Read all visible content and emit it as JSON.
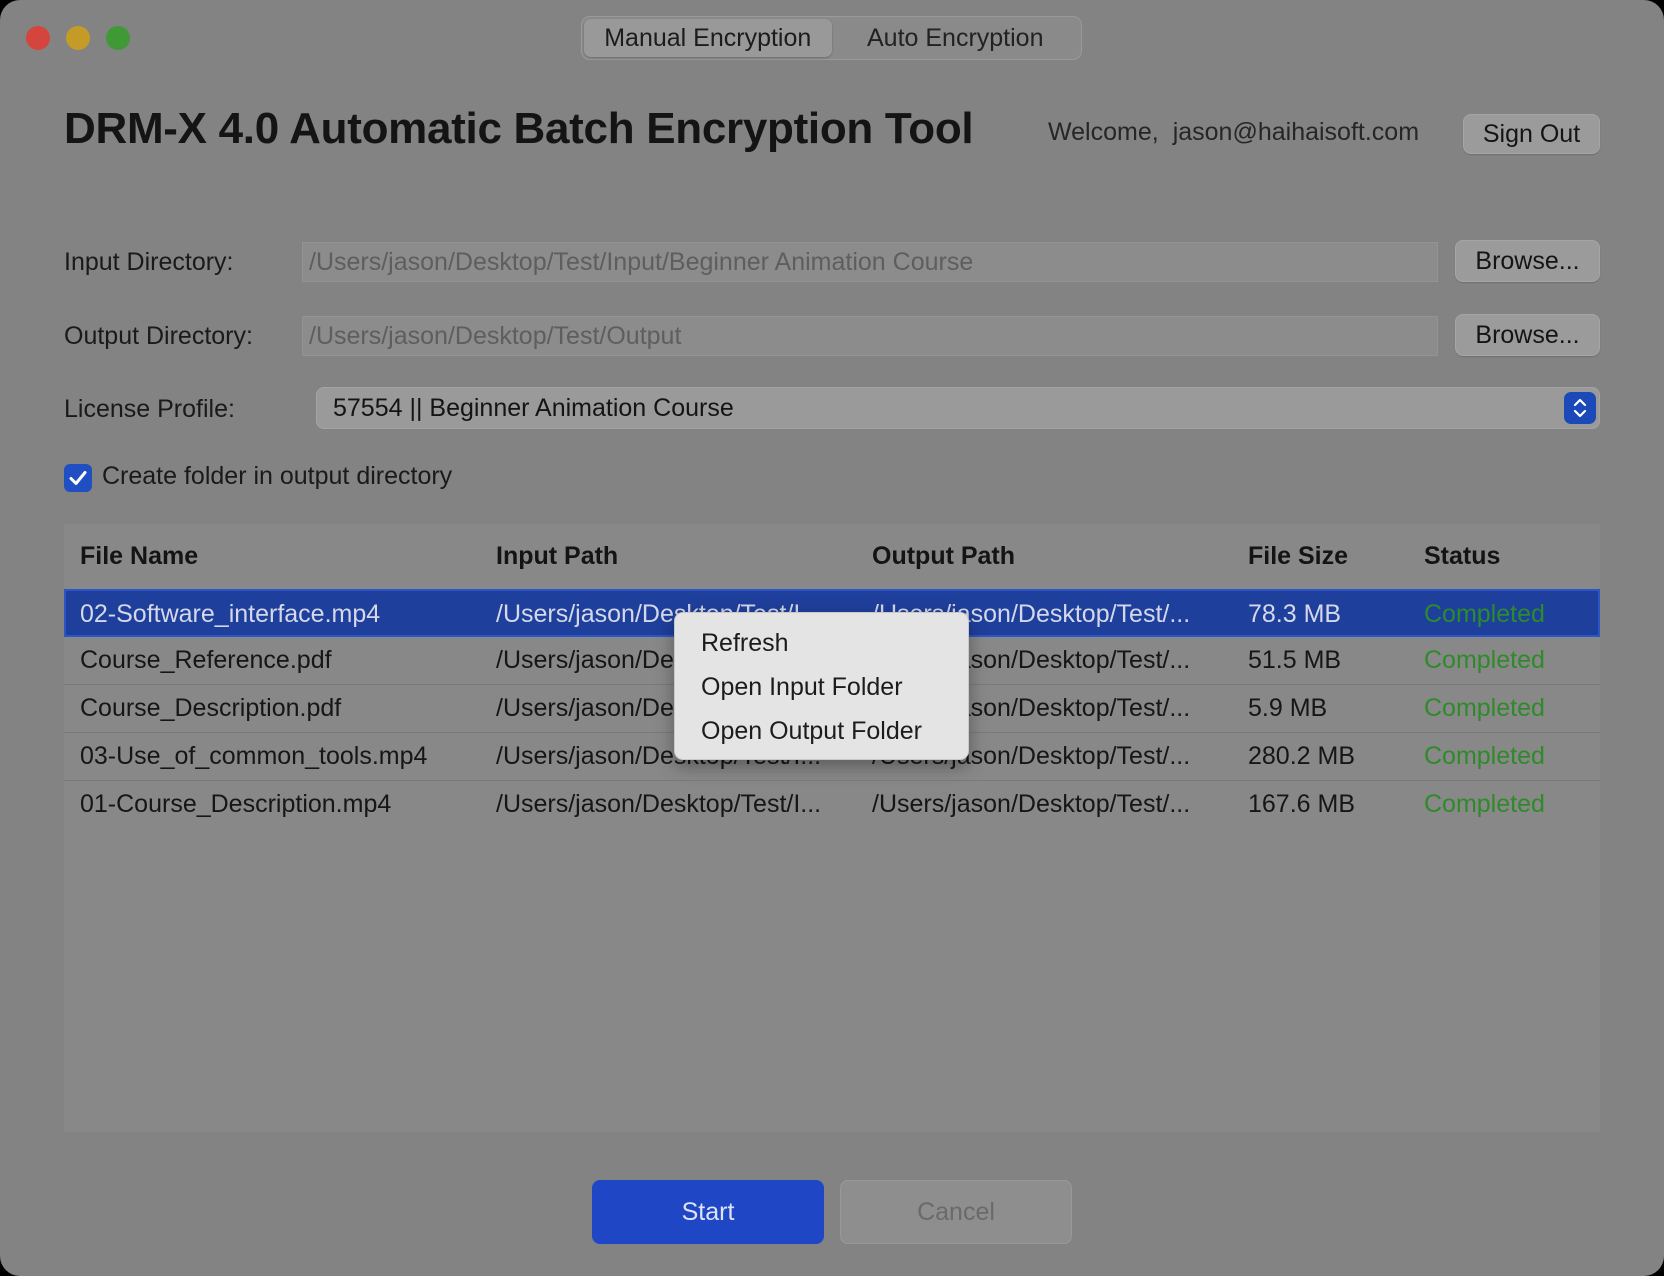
{
  "tabs": [
    {
      "label": "Manual Encryption",
      "active": true
    },
    {
      "label": "Auto Encryption",
      "active": false
    }
  ],
  "header": {
    "title": "DRM-X 4.0 Automatic Batch Encryption Tool",
    "welcome_label": "Welcome,",
    "user_email": "jason@haihaisoft.com",
    "sign_out_label": "Sign Out"
  },
  "form": {
    "input_dir_label": "Input Directory:",
    "input_dir_value": "/Users/jason/Desktop/Test/Input/Beginner Animation Course",
    "output_dir_label": "Output Directory:",
    "output_dir_value": "/Users/jason/Desktop/Test/Output",
    "browse_label": "Browse...",
    "license_label": "License Profile:",
    "license_value": "57554 || Beginner Animation Course",
    "create_folder_label": "Create folder in output directory",
    "create_folder_checked": true
  },
  "table": {
    "columns": [
      "File Name",
      "Input Path",
      "Output Path",
      "File Size",
      "Status"
    ],
    "rows": [
      {
        "name": "02-Software_interface.mp4",
        "input": "/Users/jason/Desktop/Test/I...",
        "output": "/Users/jason/Desktop/Test/...",
        "size": "78.3 MB",
        "status": "Completed",
        "selected": true
      },
      {
        "name": "Course_Reference.pdf",
        "input": "/Users/jason/Desktop/Test/I...",
        "output": "/Users/jason/Desktop/Test/...",
        "size": "51.5 MB",
        "status": "Completed"
      },
      {
        "name": "Course_Description.pdf",
        "input": "/Users/jason/Desktop/Test/I...",
        "output": "/Users/jason/Desktop/Test/...",
        "size": "5.9 MB",
        "status": "Completed"
      },
      {
        "name": "03-Use_of_common_tools.mp4",
        "input": "/Users/jason/Desktop/Test/I...",
        "output": "/Users/jason/Desktop/Test/...",
        "size": "280.2 MB",
        "status": "Completed"
      },
      {
        "name": "01-Course_Description.mp4",
        "input": "/Users/jason/Desktop/Test/I...",
        "output": "/Users/jason/Desktop/Test/...",
        "size": "167.6 MB",
        "status": "Completed"
      }
    ]
  },
  "context_menu": {
    "items": [
      "Refresh",
      "Open Input Folder",
      "Open Output Folder"
    ]
  },
  "footer": {
    "start_label": "Start",
    "cancel_label": "Cancel"
  },
  "colors": {
    "accent": "#1f46c4",
    "status_completed": "#2f8a2a",
    "traffic_red": "#d3453d",
    "traffic_yellow": "#c49b26",
    "traffic_green": "#3f9a35"
  }
}
